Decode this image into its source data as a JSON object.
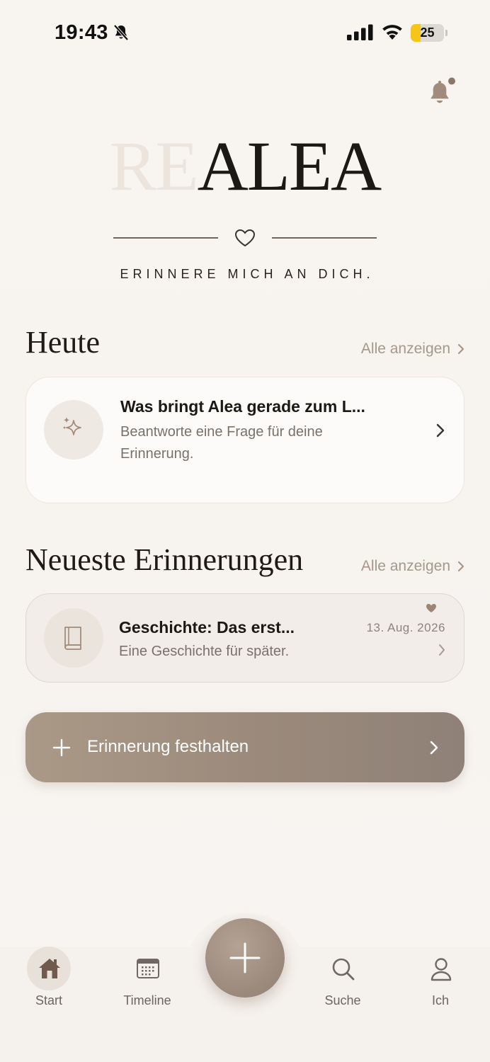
{
  "status_bar": {
    "time": "19:43",
    "battery": "25",
    "battery_color": "#f5c518"
  },
  "header": {
    "logo_prefix": "RE",
    "logo_main": "ALEA",
    "tagline": "ERINNERE MICH AN DICH."
  },
  "today": {
    "title": "Heute",
    "see_all": "Alle anzeigen",
    "card": {
      "icon": "sparkles-icon",
      "title": "Was bringt Alea gerade zum L...",
      "subtitle_line1": "Beantworte eine Frage für deine",
      "subtitle_line2": "Erinnerung."
    }
  },
  "recent": {
    "title": "Neueste Erinnerungen",
    "see_all": "Alle anzeigen",
    "items": [
      {
        "icon": "book-icon",
        "title": "Geschichte: Das erst...",
        "subtitle": "Eine Geschichte für später.",
        "date": "13. Aug. 2026",
        "favorite": true
      }
    ]
  },
  "cta": {
    "label": "Erinnerung festhalten"
  },
  "tab_bar": {
    "tabs": [
      {
        "label": "Start",
        "icon": "home-icon",
        "active": true
      },
      {
        "label": "Timeline",
        "icon": "calendar-icon",
        "active": false
      },
      {
        "label": "Suche",
        "icon": "search-icon",
        "active": false
      },
      {
        "label": "Ich",
        "icon": "person-icon",
        "active": false
      }
    ],
    "fab_icon": "plus-icon"
  },
  "colors": {
    "accent": "#a69888",
    "background": "#f8f5f1",
    "text_dark": "#1c1814"
  }
}
